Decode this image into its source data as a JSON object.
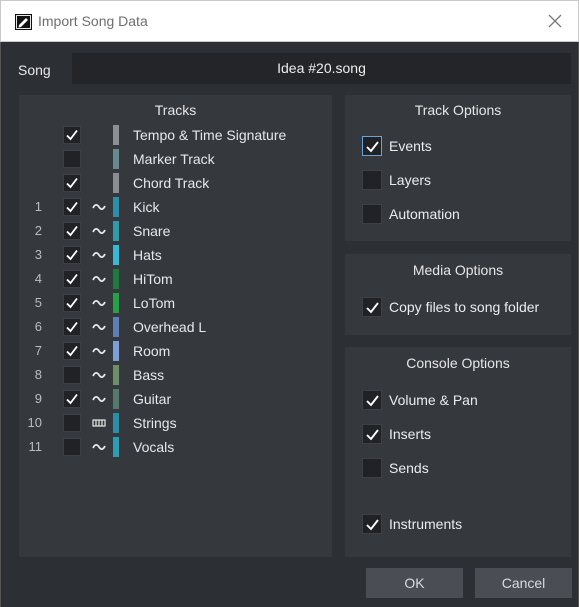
{
  "window": {
    "title": "Import Song Data"
  },
  "song": {
    "label": "Song",
    "value": "Idea #20.song"
  },
  "tracks": {
    "header": "Tracks",
    "items": [
      {
        "num": "",
        "checked": true,
        "type": "none",
        "color": "#8c9096",
        "name": "Tempo & Time Signature"
      },
      {
        "num": "",
        "checked": false,
        "type": "none",
        "color": "#67888f",
        "name": "Marker Track"
      },
      {
        "num": "",
        "checked": true,
        "type": "none",
        "color": "#8a8e93",
        "name": "Chord Track"
      },
      {
        "num": "1",
        "checked": true,
        "type": "audio",
        "color": "#2e8da8",
        "name": "Kick"
      },
      {
        "num": "2",
        "checked": true,
        "type": "audio",
        "color": "#2f9aa8",
        "name": "Snare"
      },
      {
        "num": "3",
        "checked": true,
        "type": "audio",
        "color": "#35b9d6",
        "name": "Hats"
      },
      {
        "num": "4",
        "checked": true,
        "type": "audio",
        "color": "#1e7a3c",
        "name": "HiTom"
      },
      {
        "num": "5",
        "checked": true,
        "type": "audio",
        "color": "#26a148",
        "name": "LoTom"
      },
      {
        "num": "6",
        "checked": true,
        "type": "audio",
        "color": "#5b7fb6",
        "name": "Overhead L"
      },
      {
        "num": "7",
        "checked": true,
        "type": "audio",
        "color": "#7e9fd6",
        "name": "Room"
      },
      {
        "num": "8",
        "checked": false,
        "type": "audio",
        "color": "#6f8f6a",
        "name": "Bass"
      },
      {
        "num": "9",
        "checked": true,
        "type": "audio",
        "color": "#56796f",
        "name": "Guitar"
      },
      {
        "num": "10",
        "checked": false,
        "type": "instrument",
        "color": "#2a8fa6",
        "name": "Strings"
      },
      {
        "num": "11",
        "checked": false,
        "type": "audio",
        "color": "#2b9db5",
        "name": "Vocals"
      }
    ]
  },
  "track_options": {
    "header": "Track Options",
    "items": [
      {
        "label": "Events",
        "checked": true
      },
      {
        "label": "Layers",
        "checked": false
      },
      {
        "label": "Automation",
        "checked": false
      }
    ]
  },
  "media_options": {
    "header": "Media Options",
    "items": [
      {
        "label": "Copy files to song folder",
        "checked": true
      }
    ]
  },
  "console_options": {
    "header": "Console Options",
    "items": [
      {
        "label": "Volume & Pan",
        "checked": true
      },
      {
        "label": "Inserts",
        "checked": true
      },
      {
        "label": "Sends",
        "checked": false
      },
      {
        "label": "Instruments",
        "checked": true
      }
    ]
  },
  "buttons": {
    "ok": "OK",
    "cancel": "Cancel"
  }
}
